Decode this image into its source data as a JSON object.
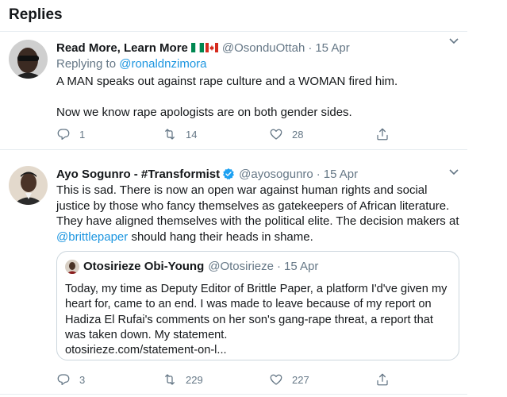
{
  "header": {
    "title": "Replies"
  },
  "tweets": [
    {
      "display_name": "Read More, Learn More",
      "flags": [
        "nigeria-flag",
        "canada-flag"
      ],
      "handle": "@OsonduOttah",
      "separator": "·",
      "date": "15 Apr",
      "reply_prefix": "Replying to",
      "reply_to": "@ronaldnzimora",
      "text_lines": [
        "A MAN speaks out against rape culture and a WOMAN fired him.",
        "Now we know rape apologists are on both gender sides."
      ],
      "counts": {
        "replies": "1",
        "retweets": "14",
        "likes": "28"
      }
    },
    {
      "display_name": "Ayo Sogunro - #Transformist",
      "verified": true,
      "handle": "@ayosogunro",
      "separator": "·",
      "date": "15 Apr",
      "text_main": "This is sad. There is now an open war against human rights and social justice by those who fancy themselves as gatekeepers of African literature. They have aligned  themselves with the political elite. The decision makers at",
      "mention": "@brittlepaper",
      "text_end": " should hang their heads in shame.",
      "quote": {
        "display_name": "Otosirieze Obi-Young",
        "handle": "@Otosirieze",
        "separator": "·",
        "date": "15 Apr",
        "text": "Today, my time as Deputy Editor of Brittle Paper, a platform I'd've given my heart for, came to an end. I was made to leave because of my report on Hadiza El Rufai's comments on her son's gang-rape threat, a report that was taken down. My statement.",
        "link": "otosirieze.com/statement-on-l..."
      },
      "counts": {
        "replies": "3",
        "retweets": "229",
        "likes": "227"
      }
    }
  ],
  "icons": {
    "reply": "reply-icon",
    "retweet": "retweet-icon",
    "like": "like-icon",
    "share": "share-icon",
    "caret": "chevron-down-icon",
    "verified": "verified-badge-icon"
  },
  "colors": {
    "text": "#14171a",
    "secondary": "#657786",
    "link": "#1b95e0",
    "border": "#e6ecf0",
    "quote_border": "#ccd6dd"
  }
}
